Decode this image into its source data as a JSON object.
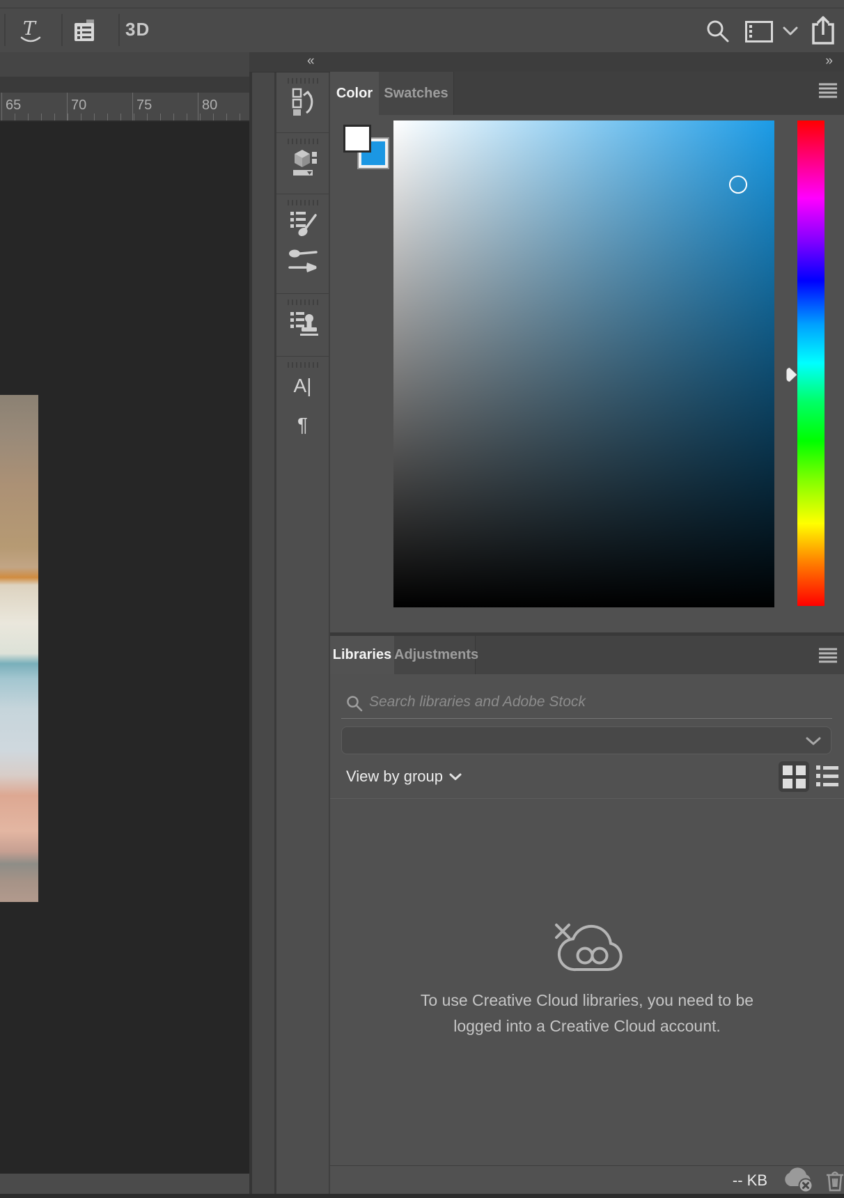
{
  "topbar": {
    "three_d_label": "3D",
    "icons": [
      "warp-text",
      "toggle-character-paragraph-panels",
      "search",
      "workspace-switcher",
      "chevron-down",
      "share"
    ]
  },
  "ruler": {
    "labels": [
      "65",
      "70",
      "75",
      "80"
    ]
  },
  "dock": {
    "collapse_label": "«",
    "panels": [
      "history",
      "3d",
      "brush-settings",
      "tool-presets",
      "clone-source",
      "character",
      "paragraph"
    ],
    "character_glyph": "A|",
    "paragraph_glyph": "¶"
  },
  "color_panel": {
    "expand_label": "»",
    "tab_color": "Color",
    "tab_swatches": "Swatches",
    "active_tab": "Color",
    "foreground_color": "#ffffff",
    "background_color": "#1b97e3"
  },
  "libraries_panel": {
    "tab_libraries": "Libraries",
    "tab_adjustments": "Adjustments",
    "active_tab": "Libraries",
    "search_placeholder": "Search libraries and Adobe Stock",
    "dropdown_value": "",
    "view_by_label": "View by group",
    "empty_message": "To use Creative Cloud libraries, you need to be logged into a Creative Cloud account.",
    "size_label": "-- KB"
  }
}
